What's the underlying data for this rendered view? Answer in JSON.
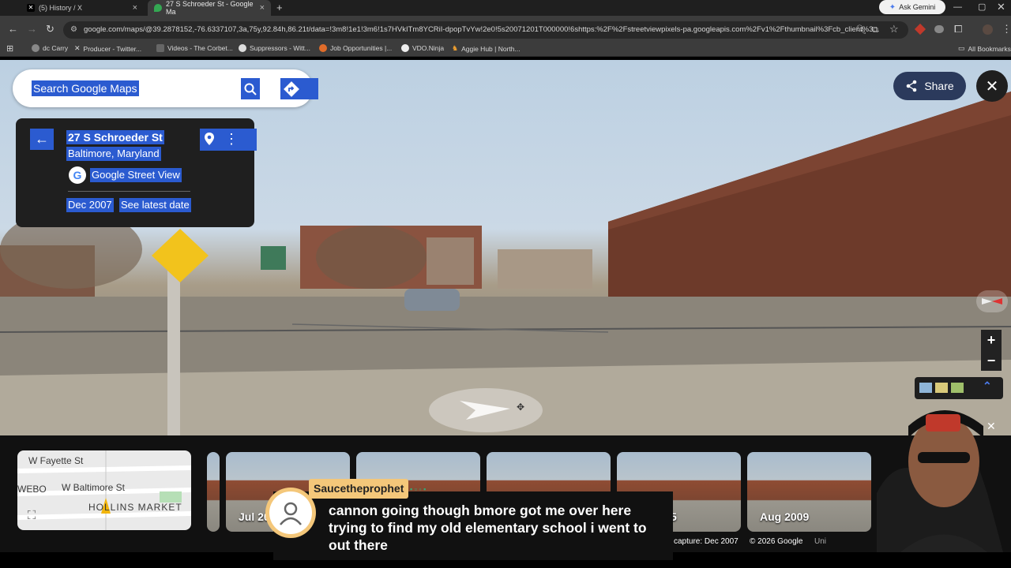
{
  "browser": {
    "tabs": [
      {
        "title": "(5) History / X",
        "icon": "x-logo-icon"
      },
      {
        "title": "27 S Schroeder St - Google Ma",
        "icon": "google-maps-icon"
      }
    ],
    "new_tab": "+",
    "gemini_label": "Ask Gemini",
    "url": "google.com/maps/@39.2878152,-76.6337107,3a,75y,92.84h,86.21t/data=!3m8!1e1!3m6!1s7HVkITm8YCRiI-dpopTvYw!2e0!5s20071201T000000!6shttps:%2F%2Fstreetviewpixels-pa.googleapis.com%2Fv1%2Fthumbnail%3Fcb_client%3...",
    "bookmarks": [
      "dc Carry",
      "Producer - Twitter...",
      "Videos - The Corbet...",
      "Suppressors - Witt...",
      "Job Opportunities |...",
      "VDO.Ninja",
      "Aggie Hub | North..."
    ],
    "all_bookmarks": "All Bookmarks"
  },
  "maps": {
    "search_placeholder": "Search Google Maps",
    "place": {
      "name": "27 S Schroeder St",
      "city": "Baltimore, Maryland",
      "source": "Google Street View",
      "capture_date": "Dec 2007",
      "latest_link": "See latest date"
    },
    "share_label": "Share",
    "zoom_in": "+",
    "zoom_out": "−"
  },
  "minimap": {
    "streets": [
      "W Fayette St",
      "W Baltimore St",
      "WEBO",
      "HOLLINS MARKET"
    ]
  },
  "timeline": {
    "thumbs": [
      {
        "date": "Jul 20"
      },
      {
        "date": ""
      },
      {
        "date": ""
      },
      {
        "date": "5"
      },
      {
        "date": "Aug 2009"
      }
    ]
  },
  "footer": {
    "capture": "capture: Dec 2007",
    "copyright": "© 2026 Google",
    "more": "Uni"
  },
  "chat": {
    "username": "Saucetheprophet",
    "message": "cannon going though bmore got me over here trying to find my old elementary school i went to out there"
  },
  "colors": {
    "highlight": "#2b5bd0",
    "chat_accent": "#f4c77a",
    "chrome_bg": "#3c3c3c"
  }
}
